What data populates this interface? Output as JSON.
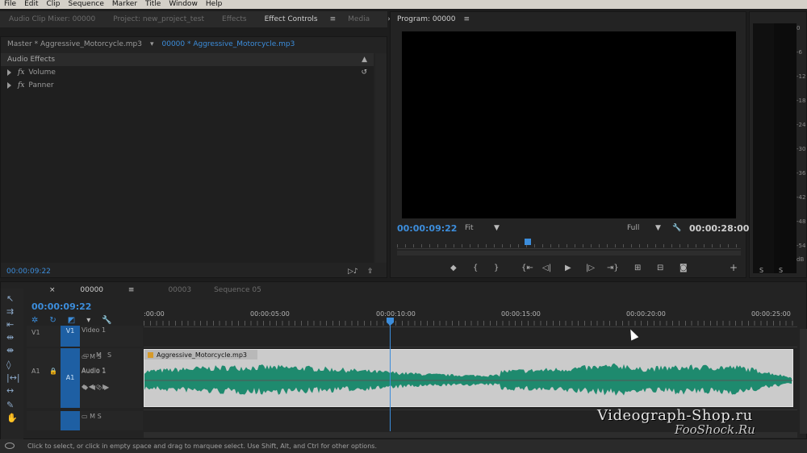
{
  "menu": [
    "File",
    "Edit",
    "Clip",
    "Sequence",
    "Marker",
    "Title",
    "Window",
    "Help"
  ],
  "left_tabs": {
    "audio_clip_mixer": "Audio Clip Mixer: 00000",
    "project": "Project: new_project_test",
    "effects": "Effects",
    "effect_controls": "Effect Controls",
    "media": "Media"
  },
  "effect_controls": {
    "master_label": "Master * Aggressive_Motorcycle.mp3",
    "seq_label": "00000 * Aggressive_Motorcycle.mp3",
    "section": "Audio Effects",
    "effects": [
      "Volume",
      "Panner"
    ],
    "timecode": "00:00:09:22"
  },
  "program": {
    "title": "Program: 00000",
    "timecode": "00:00:09:22",
    "fit": "Fit",
    "quality": "Full",
    "duration": "00:00:28:00",
    "playhead_fraction": 0.38
  },
  "meter": {
    "db_labels": [
      "0",
      "-6",
      "-12",
      "-18",
      "-24",
      "-30",
      "-36",
      "-42",
      "-48",
      "-54",
      "dB"
    ],
    "solo_labels": [
      "S",
      "S"
    ]
  },
  "timeline": {
    "tabs": [
      "00000",
      "00003",
      "Sequence 05"
    ],
    "timecode": "00:00:09:22",
    "ruler": [
      ":00:00",
      "00:00:05:00",
      "00:00:10:00",
      "00:00:15:00",
      "00:00:20:00",
      "00:00:25:00"
    ],
    "v1": "V1",
    "video_track": "Video 1",
    "a1": "A1",
    "audio_track": "Audio 1",
    "clip_name": "Aggressive_Motorcycle.mp3",
    "mute": "M",
    "solo": "S"
  },
  "status_text": "Click to select, or click in empty space and drag to marquee select. Use Shift, Alt, and Ctrl for other options.",
  "watermark": {
    "line1": "Videograph-Shop.ru",
    "line2": "FooShock.Ru"
  },
  "colors": {
    "accent": "#3c8ddb",
    "waveform": "#1e8a6e",
    "clip_bg": "#cbcbcb"
  }
}
